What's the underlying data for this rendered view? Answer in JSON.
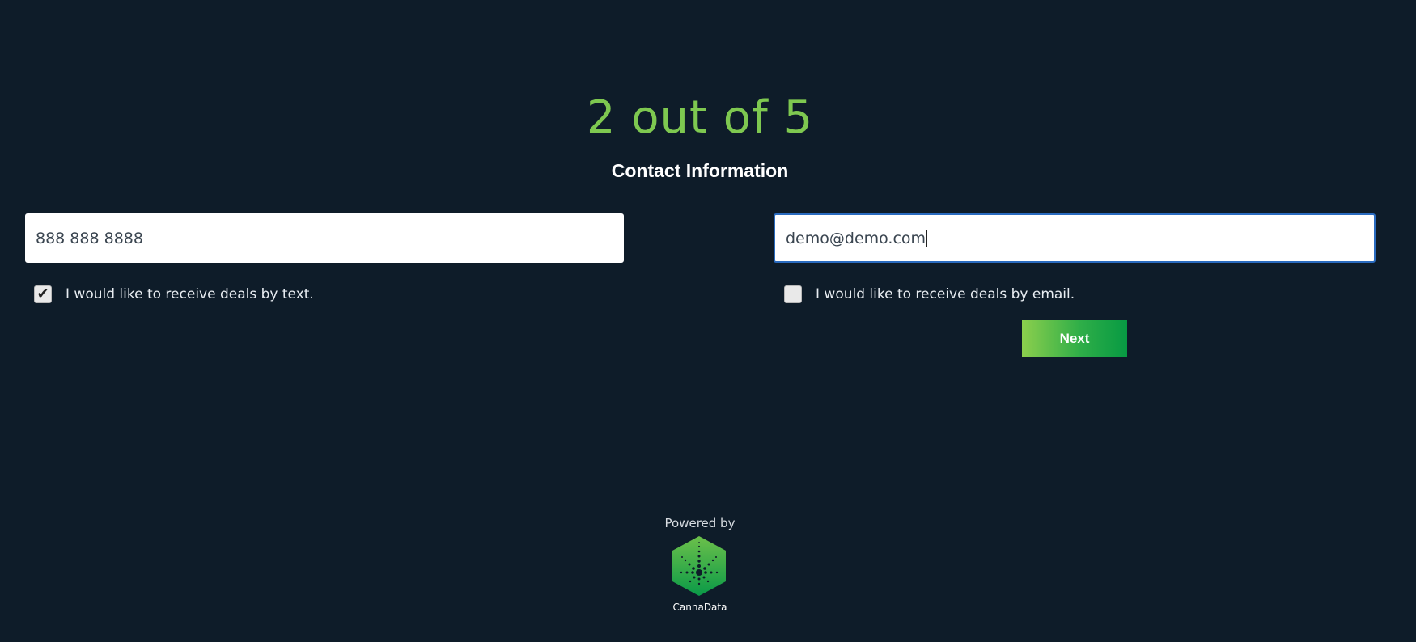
{
  "progress": {
    "label": "2 out of 5",
    "current": 2,
    "total": 5
  },
  "section_title": "Contact Information",
  "phone_field": {
    "value": "888 888 8888"
  },
  "email_field": {
    "value": "demo@demo.com"
  },
  "text_opt_in": {
    "label": "I would like to receive deals by text.",
    "checked": true,
    "check_glyph": "✔"
  },
  "email_opt_in": {
    "label": "I would like to receive deals by email.",
    "checked": false,
    "check_glyph": ""
  },
  "next_button": {
    "label": "Next"
  },
  "footer": {
    "powered_by": "Powered by",
    "brand_name": "CannaData",
    "logo_icon": "cannadata-leaf-hexagon-icon"
  },
  "colors": {
    "background": "#0e1c29",
    "accent_green": "#7ec850",
    "button_gradient_start": "#8ccf4d",
    "button_gradient_end": "#079a43",
    "focus_border": "#2a6bbf"
  }
}
